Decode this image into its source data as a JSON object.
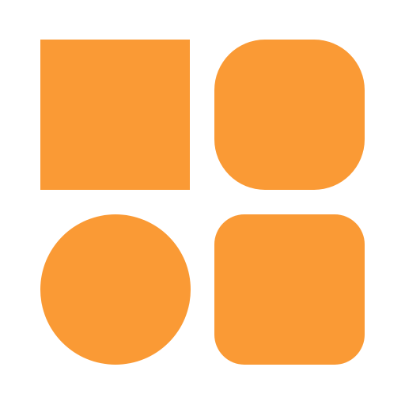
{
  "icon": {
    "name": "shape-grid-icon",
    "color": "#FA9A35",
    "background": "#FFFFFF",
    "shapes": [
      {
        "name": "square-shape-icon"
      },
      {
        "name": "squircle-shape-icon"
      },
      {
        "name": "circle-shape-icon"
      },
      {
        "name": "rounded-square-shape-icon"
      }
    ]
  }
}
